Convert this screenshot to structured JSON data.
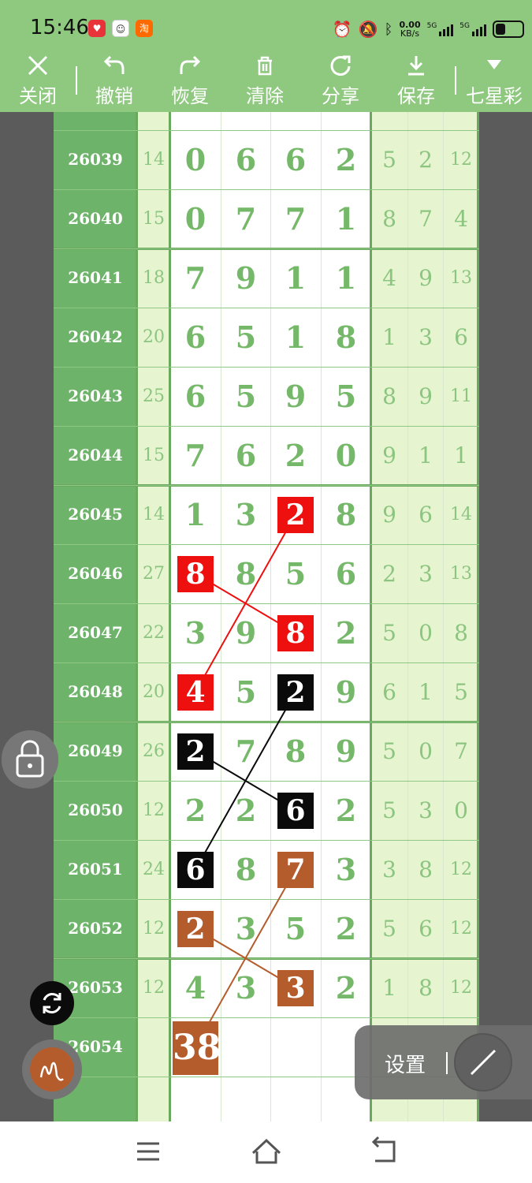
{
  "status_bar": {
    "time": "15:46",
    "net_rate_value": "0.00",
    "net_rate_unit": "KB/s",
    "sim1_label": "5G",
    "sim2_label": "5G",
    "app_badge_3": "淘"
  },
  "toolbar": {
    "close": "关闭",
    "undo": "撤销",
    "redo": "恢复",
    "clear": "清除",
    "share": "分享",
    "save": "保存",
    "lottery": "七星彩"
  },
  "chart_data": {
    "type": "table",
    "columns": [
      "issue",
      "sum",
      "d1",
      "d2",
      "d3",
      "d4",
      "a",
      "b",
      "c"
    ],
    "rows": [
      {
        "issue": "26039",
        "sum": "14",
        "digits": [
          "0",
          "6",
          "6",
          "2"
        ],
        "right": [
          "5",
          "2",
          "12"
        ]
      },
      {
        "issue": "26040",
        "sum": "15",
        "digits": [
          "0",
          "7",
          "7",
          "1"
        ],
        "right": [
          "8",
          "7",
          "4"
        ]
      },
      {
        "issue": "26041",
        "sum": "18",
        "digits": [
          "7",
          "9",
          "1",
          "1"
        ],
        "right": [
          "4",
          "9",
          "13"
        ]
      },
      {
        "issue": "26042",
        "sum": "20",
        "digits": [
          "6",
          "5",
          "1",
          "8"
        ],
        "right": [
          "1",
          "3",
          "6"
        ]
      },
      {
        "issue": "26043",
        "sum": "25",
        "digits": [
          "6",
          "5",
          "9",
          "5"
        ],
        "right": [
          "8",
          "9",
          "11"
        ]
      },
      {
        "issue": "26044",
        "sum": "15",
        "digits": [
          "7",
          "6",
          "2",
          "0"
        ],
        "right": [
          "9",
          "1",
          "1"
        ]
      },
      {
        "issue": "26045",
        "sum": "14",
        "digits": [
          "1",
          "3",
          "2",
          "8"
        ],
        "right": [
          "9",
          "6",
          "14"
        ]
      },
      {
        "issue": "26046",
        "sum": "27",
        "digits": [
          "8",
          "8",
          "5",
          "6"
        ],
        "right": [
          "2",
          "3",
          "13"
        ]
      },
      {
        "issue": "26047",
        "sum": "22",
        "digits": [
          "3",
          "9",
          "8",
          "2"
        ],
        "right": [
          "5",
          "0",
          "8"
        ]
      },
      {
        "issue": "26048",
        "sum": "20",
        "digits": [
          "4",
          "5",
          "2",
          "9"
        ],
        "right": [
          "6",
          "1",
          "5"
        ]
      },
      {
        "issue": "26049",
        "sum": "26",
        "digits": [
          "2",
          "7",
          "8",
          "9"
        ],
        "right": [
          "5",
          "0",
          "7"
        ]
      },
      {
        "issue": "26050",
        "sum": "12",
        "digits": [
          "2",
          "2",
          "6",
          "2"
        ],
        "right": [
          "5",
          "3",
          "0"
        ]
      },
      {
        "issue": "26051",
        "sum": "24",
        "digits": [
          "6",
          "8",
          "7",
          "3"
        ],
        "right": [
          "3",
          "8",
          "12"
        ]
      },
      {
        "issue": "26052",
        "sum": "12",
        "digits": [
          "2",
          "3",
          "5",
          "2"
        ],
        "right": [
          "5",
          "6",
          "12"
        ]
      },
      {
        "issue": "26053",
        "sum": "12",
        "digits": [
          "4",
          "3",
          "3",
          "2"
        ],
        "right": [
          "1",
          "8",
          "12"
        ]
      },
      {
        "issue": "26054",
        "sum": "",
        "digits": [
          "",
          "",
          "",
          ""
        ],
        "right": [
          "",
          "",
          ""
        ]
      }
    ],
    "highlights": [
      {
        "row": 6,
        "col": 2,
        "color": "red"
      },
      {
        "row": 7,
        "col": 0,
        "color": "red"
      },
      {
        "row": 8,
        "col": 2,
        "color": "red"
      },
      {
        "row": 9,
        "col": 0,
        "color": "red"
      },
      {
        "row": 9,
        "col": 2,
        "color": "black"
      },
      {
        "row": 10,
        "col": 0,
        "color": "black"
      },
      {
        "row": 11,
        "col": 2,
        "color": "black"
      },
      {
        "row": 12,
        "col": 0,
        "color": "black"
      },
      {
        "row": 12,
        "col": 2,
        "color": "brown"
      },
      {
        "row": 13,
        "col": 0,
        "color": "brown"
      },
      {
        "row": 14,
        "col": 2,
        "color": "brown"
      }
    ],
    "annotation": {
      "row": 15,
      "col": 0,
      "text": "38",
      "color": "brown"
    },
    "connectors": [
      {
        "from": [
          6,
          2
        ],
        "to": [
          9,
          0
        ],
        "color": "red"
      },
      {
        "from": [
          7,
          0
        ],
        "to": [
          8,
          2
        ],
        "color": "red"
      },
      {
        "from": [
          9,
          2
        ],
        "to": [
          12,
          0
        ],
        "color": "black"
      },
      {
        "from": [
          10,
          0
        ],
        "to": [
          11,
          2
        ],
        "color": "black"
      },
      {
        "from": [
          12,
          2
        ],
        "to": [
          15,
          0
        ],
        "color": "brown"
      },
      {
        "from": [
          13,
          0
        ],
        "to": [
          14,
          2
        ],
        "color": "brown"
      }
    ],
    "colors": {
      "red": "#ee0f0f",
      "black": "#0a0a0a",
      "brown": "#b45c2c"
    }
  },
  "floating": {
    "settings_label": "设置"
  },
  "theme": {
    "toolbar_bg": "#8fc97f",
    "issue_col_bg": "#6db36a",
    "digit_color": "#76b86a",
    "side_col_bg": "#e6f5cf"
  }
}
